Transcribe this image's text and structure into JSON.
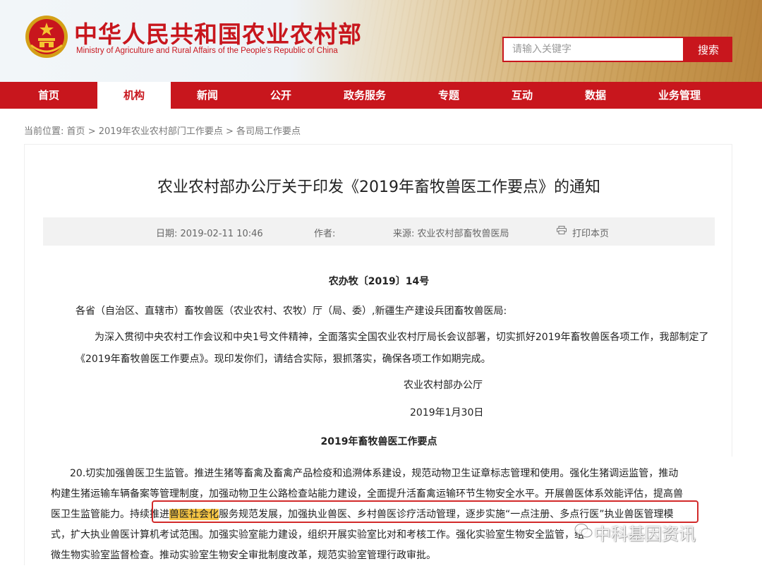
{
  "header": {
    "title_cn": "中华人民共和国农业农村部",
    "title_en": "Ministry of Agriculture and Rural Affairs of the People's Republic of China",
    "search_placeholder": "请输入关键字",
    "search_button": "搜索"
  },
  "nav": {
    "items": [
      {
        "label": "首页"
      },
      {
        "label": "机构"
      },
      {
        "label": "新闻"
      },
      {
        "label": "公开"
      },
      {
        "label": "政务服务"
      },
      {
        "label": "专题"
      },
      {
        "label": "互动"
      },
      {
        "label": "数据"
      },
      {
        "label": "业务管理"
      }
    ],
    "active": "机构"
  },
  "breadcrumb": {
    "prefix": "当前位置:",
    "items": [
      "首页",
      "2019年农业农村部门工作要点",
      "各司局工作要点"
    ],
    "separator": ">"
  },
  "article": {
    "title": "农业农村部办公厅关于印发《2019年畜牧兽医工作要点》的通知",
    "meta": {
      "date": "日期: 2019-02-11 10:46",
      "author": "作者:",
      "source": "来源: 农业农村部畜牧兽医局",
      "print": "打印本页"
    },
    "doc_no": "农办牧〔2019〕14号",
    "addressee": "各省（自治区、直辖市）畜牧兽医（农业农村、农牧）厅（局、委）,新疆生产建设兵团畜牧兽医局:",
    "body": {
      "line1": "为深入贯彻中央农村工作会议和中央1号文件精神，全面落实全国农业农村厅局长会议部署，切实抓好2019年畜牧兽医各项工作，我部制定了",
      "line2": "《2019年畜牧兽医工作要点》。现印发你们，请结合实际，狠抓落实，确保各项工作如期完成。"
    },
    "signer": "农业农村部办公厅",
    "date": "2019年1月30日",
    "section_title": "2019年畜牧兽医工作要点"
  },
  "excerpt": {
    "l1": "20.切实加强兽医卫生监管。推进生猪等畜禽及畜禽产品检疫和追溯体系建设，规范动物卫生证章标志管理和使用。强化生猪调运监管，推动",
    "l2": "构建生猪运输车辆备案等管理制度，加强动物卫生公路检查站能力建设，全面提升活畜禽运输环节生物安全水平。开展兽医体系效能评估，提高兽",
    "l3_a": "医卫生监管能力。",
    "l3_b": "持续推进",
    "l3_hl": "兽医社会化",
    "l3_c": "服务规范发展，加强执业兽医、乡村兽医诊疗活动管理，逐步实施“一点注册、多点行医”执业兽医管理模",
    "l4": "式，扩大执业兽医计算机考试范围。加强实验室能力建设，组织开展实验室比对和考核工作。强化实验室生物安全监管，组",
    "l5": "微生物实验室监督检查。推动实验室生物安全审批制度改革，规范实验室管理行政审批。"
  },
  "watermark": "中科基因资讯",
  "colors": {
    "brand_red": "#c8161d",
    "highlight": "#f6c544",
    "callout": "#d22a2a"
  }
}
